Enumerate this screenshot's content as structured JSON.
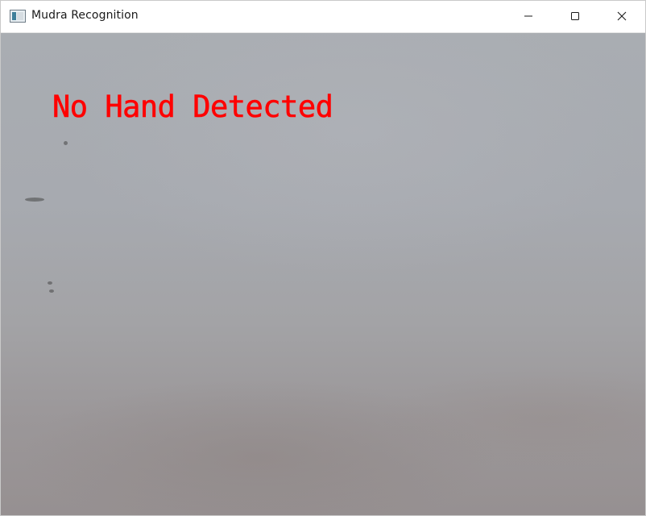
{
  "window": {
    "title": "Mudra Recognition",
    "icon": "app-window-icon",
    "controls": {
      "minimize_icon": "minimize-icon",
      "maximize_icon": "maximize-icon",
      "close_icon": "close-icon"
    }
  },
  "feed": {
    "status_text": "No Hand Detected",
    "status_color": "#ff0000"
  }
}
